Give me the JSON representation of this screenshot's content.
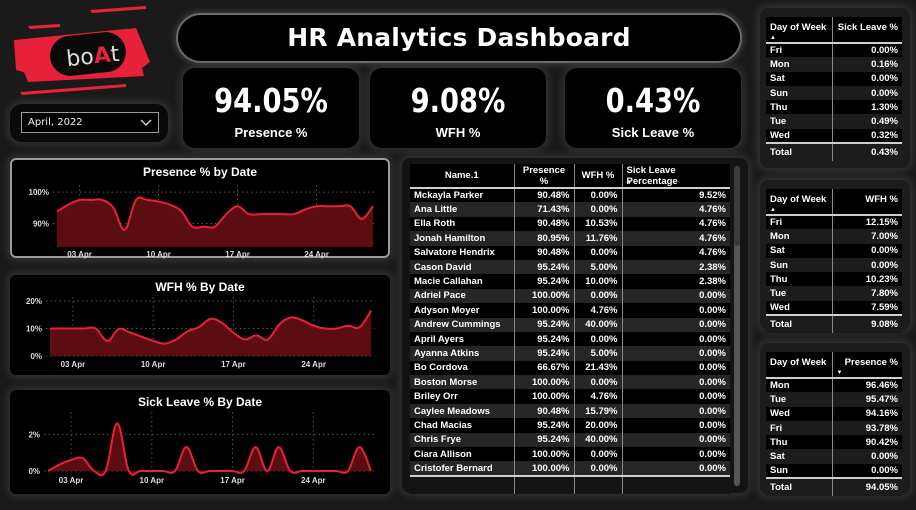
{
  "brand": {
    "logo_text": "boAt",
    "accent": "#e8213a"
  },
  "filter": {
    "selected": "April, 2022"
  },
  "header": {
    "title": "HR Analytics Dashboard"
  },
  "kpis": [
    {
      "value": "94.05%",
      "label": "Presence %"
    },
    {
      "value": "9.08%",
      "label": "WFH %"
    },
    {
      "value": "0.43%",
      "label": "Sick Leave %"
    }
  ],
  "chart_data": [
    {
      "type": "area",
      "title": "Presence % by Date",
      "xlabel": "",
      "ylabel": "",
      "x_ticks": [
        "03 Apr",
        "10 Apr",
        "17 Apr",
        "24 Apr"
      ],
      "y_ticks": [
        "90%",
        "100%"
      ],
      "ylim": [
        82.5,
        101
      ],
      "x": [
        "01 Apr",
        "02 Apr",
        "03 Apr",
        "04 Apr",
        "05 Apr",
        "06 Apr",
        "07 Apr",
        "08 Apr",
        "09 Apr",
        "10 Apr",
        "11 Apr",
        "12 Apr",
        "13 Apr",
        "14 Apr",
        "15 Apr",
        "16 Apr",
        "17 Apr",
        "18 Apr",
        "19 Apr",
        "20 Apr",
        "21 Apr",
        "22 Apr",
        "23 Apr",
        "24 Apr",
        "25 Apr",
        "26 Apr",
        "27 Apr",
        "28 Apr",
        "29 Apr"
      ],
      "values": [
        93.8,
        96.0,
        97.5,
        97.5,
        97.5,
        95.0,
        88.0,
        97.5,
        97.5,
        97.0,
        96.0,
        94.0,
        89.0,
        89.0,
        89.0,
        93.0,
        95.5,
        93.0,
        93.0,
        93.0,
        93.0,
        93.0,
        94.5,
        95.5,
        95.5,
        95.5,
        95.5,
        91.5,
        95.5
      ],
      "grid": true,
      "color": "#e8213a"
    },
    {
      "type": "area",
      "title": "WFH % By Date",
      "xlabel": "",
      "ylabel": "",
      "x_ticks": [
        "03 Apr",
        "10 Apr",
        "17 Apr",
        "24 Apr"
      ],
      "y_ticks": [
        "0%",
        "10%",
        "20%"
      ],
      "ylim": [
        0,
        20
      ],
      "x": [
        "01 Apr",
        "02 Apr",
        "03 Apr",
        "04 Apr",
        "05 Apr",
        "06 Apr",
        "07 Apr",
        "08 Apr",
        "09 Apr",
        "10 Apr",
        "11 Apr",
        "12 Apr",
        "13 Apr",
        "14 Apr",
        "15 Apr",
        "16 Apr",
        "17 Apr",
        "18 Apr",
        "19 Apr",
        "20 Apr",
        "21 Apr",
        "22 Apr",
        "23 Apr",
        "24 Apr",
        "25 Apr",
        "26 Apr",
        "27 Apr",
        "28 Apr",
        "29 Apr"
      ],
      "values": [
        10.0,
        10.0,
        10.0,
        10.0,
        10.0,
        5.5,
        9.8,
        8.5,
        7.0,
        5.5,
        4.5,
        6.0,
        9.0,
        10.5,
        13.5,
        12.0,
        8.5,
        6.0,
        7.5,
        6.0,
        11.5,
        14.0,
        13.0,
        11.0,
        10.0,
        10.0,
        11.0,
        10.5,
        16.5
      ],
      "grid": true,
      "color": "#e8213a"
    },
    {
      "type": "area",
      "title": "Sick Leave % By Date",
      "xlabel": "",
      "ylabel": "",
      "x_ticks": [
        "03 Apr",
        "10 Apr",
        "17 Apr",
        "24 Apr"
      ],
      "y_ticks": [
        "0%",
        "2%"
      ],
      "ylim": [
        0,
        3
      ],
      "x": [
        "01 Apr",
        "02 Apr",
        "03 Apr",
        "04 Apr",
        "05 Apr",
        "06 Apr",
        "07 Apr",
        "08 Apr",
        "09 Apr",
        "10 Apr",
        "11 Apr",
        "12 Apr",
        "13 Apr",
        "14 Apr",
        "15 Apr",
        "16 Apr",
        "17 Apr",
        "18 Apr",
        "19 Apr",
        "20 Apr",
        "21 Apr",
        "22 Apr",
        "23 Apr",
        "24 Apr",
        "25 Apr",
        "26 Apr",
        "27 Apr",
        "28 Apr",
        "29 Apr"
      ],
      "values": [
        0.0,
        0.35,
        0.6,
        0.7,
        0.0,
        0.0,
        2.6,
        0.0,
        0.0,
        0.0,
        0.0,
        0.0,
        1.3,
        0.0,
        0.0,
        0.0,
        0.0,
        0.0,
        1.3,
        0.0,
        1.3,
        0.0,
        0.0,
        0.0,
        0.0,
        0.0,
        0.0,
        1.3,
        0.0
      ],
      "grid": true,
      "color": "#e8213a"
    }
  ],
  "employee_table": {
    "columns": [
      "Name.1",
      "Presence %",
      "WFH %",
      "Sick Leave Percentage"
    ],
    "sort_column": "Sick Leave Percentage",
    "rows": [
      [
        "Mckayla Parker",
        "90.48%",
        "0.00%",
        "9.52%"
      ],
      [
        "Ana Little",
        "71.43%",
        "0.00%",
        "4.76%"
      ],
      [
        "Ella Roth",
        "90.48%",
        "10.53%",
        "4.76%"
      ],
      [
        "Jonah Hamilton",
        "80.95%",
        "11.76%",
        "4.76%"
      ],
      [
        "Salvatore Hendrix",
        "90.48%",
        "0.00%",
        "4.76%"
      ],
      [
        "Cason David",
        "95.24%",
        "5.00%",
        "2.38%"
      ],
      [
        "Macie Callahan",
        "95.24%",
        "10.00%",
        "2.38%"
      ],
      [
        "Adriel Pace",
        "100.00%",
        "0.00%",
        "0.00%"
      ],
      [
        "Adyson Moyer",
        "100.00%",
        "4.76%",
        "0.00%"
      ],
      [
        "Andrew Cummings",
        "95.24%",
        "40.00%",
        "0.00%"
      ],
      [
        "April Ayers",
        "95.24%",
        "0.00%",
        "0.00%"
      ],
      [
        "Ayanna Atkins",
        "95.24%",
        "5.00%",
        "0.00%"
      ],
      [
        "Bo Cordova",
        "66.67%",
        "21.43%",
        "0.00%"
      ],
      [
        "Boston Morse",
        "100.00%",
        "0.00%",
        "0.00%"
      ],
      [
        "Briley Orr",
        "100.00%",
        "4.76%",
        "0.00%"
      ],
      [
        "Caylee Meadows",
        "90.48%",
        "15.79%",
        "0.00%"
      ],
      [
        "Chad Macias",
        "95.24%",
        "20.00%",
        "0.00%"
      ],
      [
        "Chris Frye",
        "95.24%",
        "40.00%",
        "0.00%"
      ],
      [
        "Ciara Allison",
        "100.00%",
        "0.00%",
        "0.00%"
      ],
      [
        "Cristofer Bernard",
        "100.00%",
        "0.00%",
        "0.00%"
      ]
    ]
  },
  "sick_leave_by_day": {
    "columns": [
      "Day of Week",
      "Sick Leave %"
    ],
    "sort_column": "Day of Week",
    "rows": [
      [
        "Fri",
        "0.00%"
      ],
      [
        "Mon",
        "0.16%"
      ],
      [
        "Sat",
        "0.00%"
      ],
      [
        "Sun",
        "0.00%"
      ],
      [
        "Thu",
        "1.30%"
      ],
      [
        "Tue",
        "0.49%"
      ],
      [
        "Wed",
        "0.32%"
      ]
    ],
    "total": [
      "Total",
      "0.43%"
    ]
  },
  "wfh_by_day": {
    "columns": [
      "Day of Week",
      "WFH %"
    ],
    "sort_column": "Day of Week",
    "rows": [
      [
        "Fri",
        "12.15%"
      ],
      [
        "Mon",
        "7.00%"
      ],
      [
        "Sat",
        "0.00%"
      ],
      [
        "Sun",
        "0.00%"
      ],
      [
        "Thu",
        "10.23%"
      ],
      [
        "Tue",
        "7.80%"
      ],
      [
        "Wed",
        "7.59%"
      ]
    ],
    "total": [
      "Total",
      "9.08%"
    ]
  },
  "presence_by_day": {
    "columns": [
      "Day of Week",
      "Presence %"
    ],
    "sort_column": "Presence %",
    "rows": [
      [
        "Mon",
        "96.46%"
      ],
      [
        "Tue",
        "95.47%"
      ],
      [
        "Wed",
        "94.16%"
      ],
      [
        "Fri",
        "93.78%"
      ],
      [
        "Thu",
        "90.42%"
      ],
      [
        "Sat",
        "0.00%"
      ],
      [
        "Sun",
        "0.00%"
      ]
    ],
    "total": [
      "Total",
      "94.05%"
    ]
  },
  "icons": {
    "dropdown": "chevron-down-icon",
    "sort_asc": "sort-ascending-icon",
    "sort_desc": "sort-descending-icon"
  }
}
